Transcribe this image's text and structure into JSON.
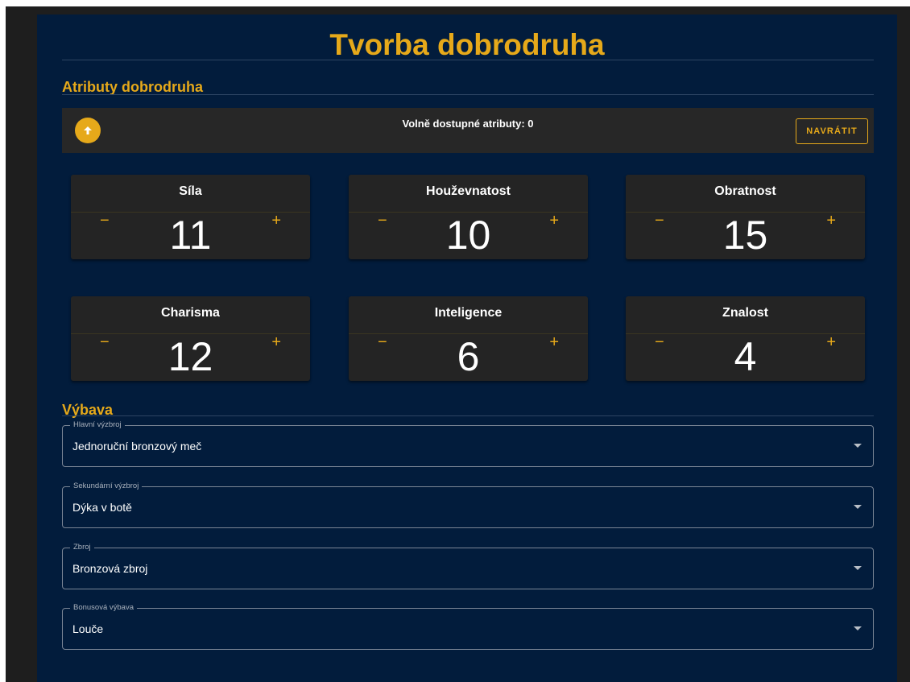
{
  "page": {
    "title": "Tvorba dobrodruha"
  },
  "attributes": {
    "section_title": "Atributy dobrodruha",
    "free_label": "Volně dostupné atributy: 0",
    "reset_label": "NAVRÁTIT",
    "items": [
      {
        "name": "Síla",
        "value": "11"
      },
      {
        "name": "Houževnatost",
        "value": "10"
      },
      {
        "name": "Obratnost",
        "value": "15"
      },
      {
        "name": "Charisma",
        "value": "12"
      },
      {
        "name": "Inteligence",
        "value": "6"
      },
      {
        "name": "Znalost",
        "value": "4"
      }
    ],
    "minus_symbol": "−",
    "plus_symbol": "+"
  },
  "equipment": {
    "section_title": "Výbava",
    "fields": [
      {
        "label": "Hlavní výzbroj",
        "value": "Jednoruční bronzový meč"
      },
      {
        "label": "Sekundární výzbroj",
        "value": "Dýka v botě"
      },
      {
        "label": "Zbroj",
        "value": "Bronzová zbroj"
      },
      {
        "label": "Bonusová výbava",
        "value": "Louče"
      }
    ]
  },
  "colors": {
    "accent": "#e6a91a",
    "panel": "#021c3c",
    "card": "#242424"
  }
}
